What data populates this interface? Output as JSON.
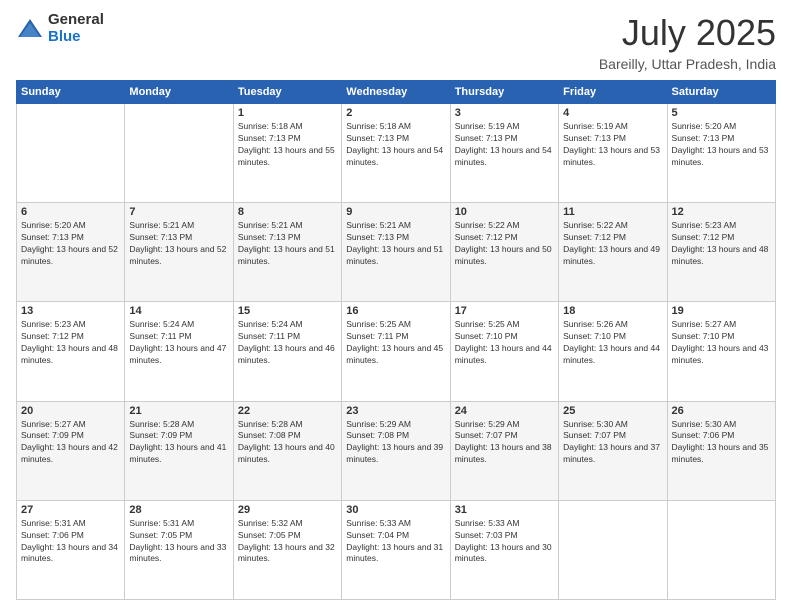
{
  "logo": {
    "general": "General",
    "blue": "Blue"
  },
  "header": {
    "month": "July 2025",
    "location": "Bareilly, Uttar Pradesh, India"
  },
  "weekdays": [
    "Sunday",
    "Monday",
    "Tuesday",
    "Wednesday",
    "Thursday",
    "Friday",
    "Saturday"
  ],
  "weeks": [
    [
      {
        "day": "",
        "sunrise": "",
        "sunset": "",
        "daylight": ""
      },
      {
        "day": "",
        "sunrise": "",
        "sunset": "",
        "daylight": ""
      },
      {
        "day": "1",
        "sunrise": "Sunrise: 5:18 AM",
        "sunset": "Sunset: 7:13 PM",
        "daylight": "Daylight: 13 hours and 55 minutes."
      },
      {
        "day": "2",
        "sunrise": "Sunrise: 5:18 AM",
        "sunset": "Sunset: 7:13 PM",
        "daylight": "Daylight: 13 hours and 54 minutes."
      },
      {
        "day": "3",
        "sunrise": "Sunrise: 5:19 AM",
        "sunset": "Sunset: 7:13 PM",
        "daylight": "Daylight: 13 hours and 54 minutes."
      },
      {
        "day": "4",
        "sunrise": "Sunrise: 5:19 AM",
        "sunset": "Sunset: 7:13 PM",
        "daylight": "Daylight: 13 hours and 53 minutes."
      },
      {
        "day": "5",
        "sunrise": "Sunrise: 5:20 AM",
        "sunset": "Sunset: 7:13 PM",
        "daylight": "Daylight: 13 hours and 53 minutes."
      }
    ],
    [
      {
        "day": "6",
        "sunrise": "Sunrise: 5:20 AM",
        "sunset": "Sunset: 7:13 PM",
        "daylight": "Daylight: 13 hours and 52 minutes."
      },
      {
        "day": "7",
        "sunrise": "Sunrise: 5:21 AM",
        "sunset": "Sunset: 7:13 PM",
        "daylight": "Daylight: 13 hours and 52 minutes."
      },
      {
        "day": "8",
        "sunrise": "Sunrise: 5:21 AM",
        "sunset": "Sunset: 7:13 PM",
        "daylight": "Daylight: 13 hours and 51 minutes."
      },
      {
        "day": "9",
        "sunrise": "Sunrise: 5:21 AM",
        "sunset": "Sunset: 7:13 PM",
        "daylight": "Daylight: 13 hours and 51 minutes."
      },
      {
        "day": "10",
        "sunrise": "Sunrise: 5:22 AM",
        "sunset": "Sunset: 7:12 PM",
        "daylight": "Daylight: 13 hours and 50 minutes."
      },
      {
        "day": "11",
        "sunrise": "Sunrise: 5:22 AM",
        "sunset": "Sunset: 7:12 PM",
        "daylight": "Daylight: 13 hours and 49 minutes."
      },
      {
        "day": "12",
        "sunrise": "Sunrise: 5:23 AM",
        "sunset": "Sunset: 7:12 PM",
        "daylight": "Daylight: 13 hours and 48 minutes."
      }
    ],
    [
      {
        "day": "13",
        "sunrise": "Sunrise: 5:23 AM",
        "sunset": "Sunset: 7:12 PM",
        "daylight": "Daylight: 13 hours and 48 minutes."
      },
      {
        "day": "14",
        "sunrise": "Sunrise: 5:24 AM",
        "sunset": "Sunset: 7:11 PM",
        "daylight": "Daylight: 13 hours and 47 minutes."
      },
      {
        "day": "15",
        "sunrise": "Sunrise: 5:24 AM",
        "sunset": "Sunset: 7:11 PM",
        "daylight": "Daylight: 13 hours and 46 minutes."
      },
      {
        "day": "16",
        "sunrise": "Sunrise: 5:25 AM",
        "sunset": "Sunset: 7:11 PM",
        "daylight": "Daylight: 13 hours and 45 minutes."
      },
      {
        "day": "17",
        "sunrise": "Sunrise: 5:25 AM",
        "sunset": "Sunset: 7:10 PM",
        "daylight": "Daylight: 13 hours and 44 minutes."
      },
      {
        "day": "18",
        "sunrise": "Sunrise: 5:26 AM",
        "sunset": "Sunset: 7:10 PM",
        "daylight": "Daylight: 13 hours and 44 minutes."
      },
      {
        "day": "19",
        "sunrise": "Sunrise: 5:27 AM",
        "sunset": "Sunset: 7:10 PM",
        "daylight": "Daylight: 13 hours and 43 minutes."
      }
    ],
    [
      {
        "day": "20",
        "sunrise": "Sunrise: 5:27 AM",
        "sunset": "Sunset: 7:09 PM",
        "daylight": "Daylight: 13 hours and 42 minutes."
      },
      {
        "day": "21",
        "sunrise": "Sunrise: 5:28 AM",
        "sunset": "Sunset: 7:09 PM",
        "daylight": "Daylight: 13 hours and 41 minutes."
      },
      {
        "day": "22",
        "sunrise": "Sunrise: 5:28 AM",
        "sunset": "Sunset: 7:08 PM",
        "daylight": "Daylight: 13 hours and 40 minutes."
      },
      {
        "day": "23",
        "sunrise": "Sunrise: 5:29 AM",
        "sunset": "Sunset: 7:08 PM",
        "daylight": "Daylight: 13 hours and 39 minutes."
      },
      {
        "day": "24",
        "sunrise": "Sunrise: 5:29 AM",
        "sunset": "Sunset: 7:07 PM",
        "daylight": "Daylight: 13 hours and 38 minutes."
      },
      {
        "day": "25",
        "sunrise": "Sunrise: 5:30 AM",
        "sunset": "Sunset: 7:07 PM",
        "daylight": "Daylight: 13 hours and 37 minutes."
      },
      {
        "day": "26",
        "sunrise": "Sunrise: 5:30 AM",
        "sunset": "Sunset: 7:06 PM",
        "daylight": "Daylight: 13 hours and 35 minutes."
      }
    ],
    [
      {
        "day": "27",
        "sunrise": "Sunrise: 5:31 AM",
        "sunset": "Sunset: 7:06 PM",
        "daylight": "Daylight: 13 hours and 34 minutes."
      },
      {
        "day": "28",
        "sunrise": "Sunrise: 5:31 AM",
        "sunset": "Sunset: 7:05 PM",
        "daylight": "Daylight: 13 hours and 33 minutes."
      },
      {
        "day": "29",
        "sunrise": "Sunrise: 5:32 AM",
        "sunset": "Sunset: 7:05 PM",
        "daylight": "Daylight: 13 hours and 32 minutes."
      },
      {
        "day": "30",
        "sunrise": "Sunrise: 5:33 AM",
        "sunset": "Sunset: 7:04 PM",
        "daylight": "Daylight: 13 hours and 31 minutes."
      },
      {
        "day": "31",
        "sunrise": "Sunrise: 5:33 AM",
        "sunset": "Sunset: 7:03 PM",
        "daylight": "Daylight: 13 hours and 30 minutes."
      },
      {
        "day": "",
        "sunrise": "",
        "sunset": "",
        "daylight": ""
      },
      {
        "day": "",
        "sunrise": "",
        "sunset": "",
        "daylight": ""
      }
    ]
  ]
}
